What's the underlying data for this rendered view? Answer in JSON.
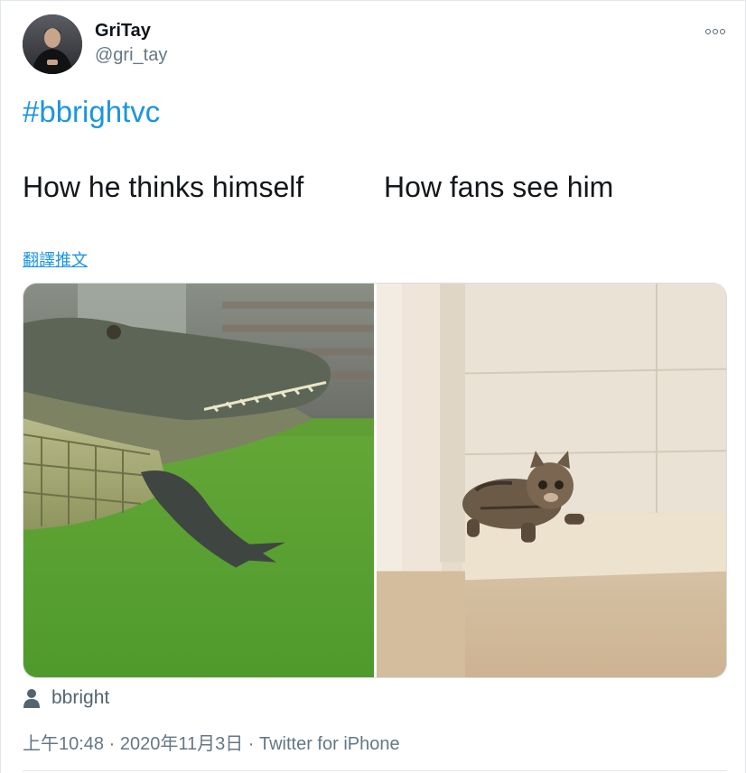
{
  "user": {
    "display_name": "GriTay",
    "handle": "@gri_tay",
    "avatar_icon": "avatar-photo"
  },
  "tweet": {
    "hashtag": "#bbrightvc",
    "caption_left": "How he thinks himself",
    "caption_right": "How fans see him",
    "translate_label": "翻譯推文",
    "media": [
      {
        "icon": "alligator-photo"
      },
      {
        "icon": "cat-photo"
      }
    ],
    "tagged_user": "bbright",
    "meta_line": "上午10:48 · 2020年11月3日 · Twitter for iPhone"
  },
  "colors": {
    "link": "#1b95e0",
    "secondary_text": "#657786",
    "primary_text": "#0f1419",
    "border": "#e1e8ed"
  }
}
